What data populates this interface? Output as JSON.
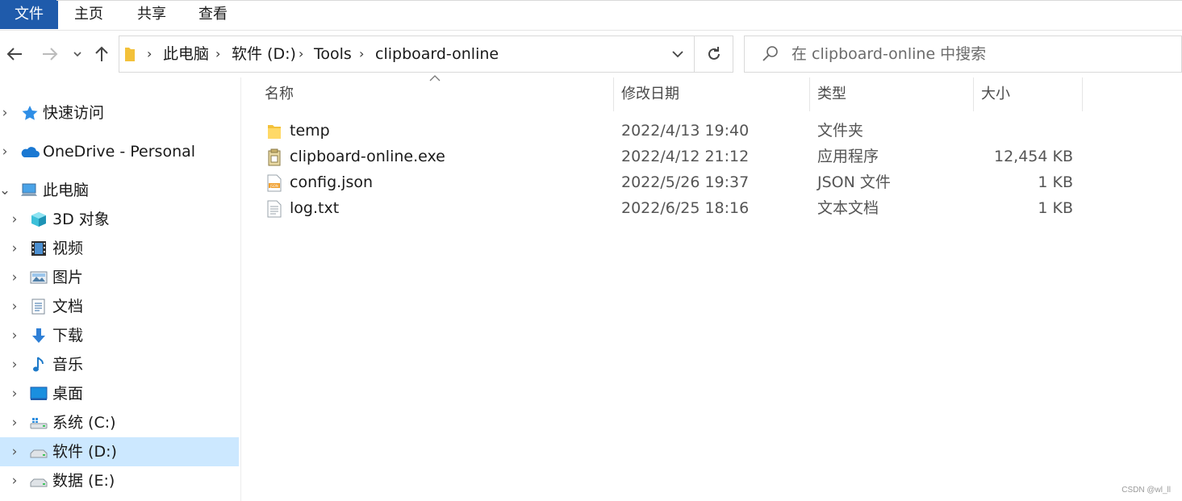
{
  "ribbon": {
    "tabs": [
      "文件",
      "主页",
      "共享",
      "查看"
    ]
  },
  "navigation": {
    "back_icon": "arrow-left-icon",
    "forward_icon": "arrow-right-icon",
    "recent_icon": "chevron-down-icon",
    "up_icon": "arrow-up-icon",
    "breadcrumbs": [
      "此电脑",
      "软件 (D:)",
      "Tools",
      "clipboard-online"
    ],
    "refresh_icon": "refresh-icon"
  },
  "search": {
    "placeholder": "在 clipboard-online 中搜索"
  },
  "sidebar": {
    "items": [
      {
        "label": "快速访问",
        "icon": "star-icon"
      },
      {
        "label": "OneDrive - Personal",
        "icon": "cloud-icon"
      },
      {
        "label": "此电脑",
        "icon": "computer-icon"
      },
      {
        "label": "3D 对象",
        "icon": "cube-icon"
      },
      {
        "label": "视频",
        "icon": "film-icon"
      },
      {
        "label": "图片",
        "icon": "picture-icon"
      },
      {
        "label": "文档",
        "icon": "document-icon"
      },
      {
        "label": "下载",
        "icon": "download-icon"
      },
      {
        "label": "音乐",
        "icon": "music-icon"
      },
      {
        "label": "桌面",
        "icon": "desktop-icon"
      },
      {
        "label": "系统 (C:)",
        "icon": "drive-windows-icon"
      },
      {
        "label": "软件 (D:)",
        "icon": "drive-icon",
        "selected": true
      },
      {
        "label": "数据 (E:)",
        "icon": "drive-icon"
      }
    ]
  },
  "columns": [
    "名称",
    "修改日期",
    "类型",
    "大小"
  ],
  "files": [
    {
      "name": "temp",
      "date": "2022/4/13 19:40",
      "type": "文件夹",
      "size": "",
      "icon": "folder-icon"
    },
    {
      "name": "clipboard-online.exe",
      "date": "2022/4/12 21:12",
      "type": "应用程序",
      "size": "12,454 KB",
      "icon": "executable-icon"
    },
    {
      "name": "config.json",
      "date": "2022/5/26 19:37",
      "type": "JSON 文件",
      "size": "1 KB",
      "icon": "json-file-icon"
    },
    {
      "name": "log.txt",
      "date": "2022/6/25 18:16",
      "type": "文本文档",
      "size": "1 KB",
      "icon": "text-file-icon"
    }
  ],
  "watermark": "CSDN @wl_ll",
  "colors": {
    "accent": "#1f5bab",
    "selection": "#cce8ff",
    "folder": "#f3c13a"
  }
}
